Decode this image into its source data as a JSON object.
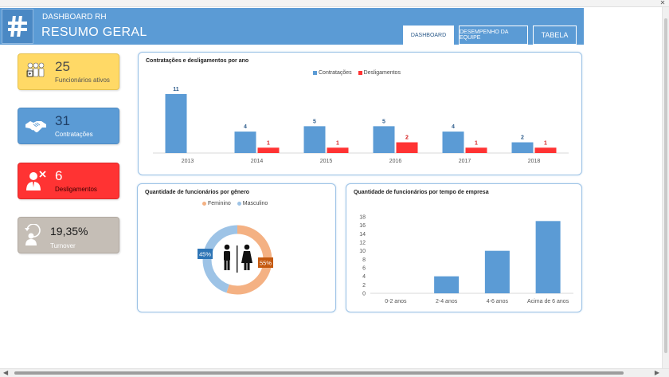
{
  "window": {
    "close_glyph": "✕"
  },
  "header": {
    "subtitle": "DASHBOARD RH",
    "title": "RESUMO GERAL",
    "tabs": [
      {
        "label": "DASHBOARD",
        "active": true
      },
      {
        "label": "DESEMPENHO DA EQUIPE",
        "active": false
      },
      {
        "label": "TABELA",
        "active": false
      }
    ]
  },
  "kpis": {
    "ativos": {
      "value": "25",
      "label": "Funcionários ativos",
      "icon": "people-icon",
      "color": "#ffd966"
    },
    "contratacoes": {
      "value": "31",
      "label": "Contratações",
      "icon": "handshake-icon",
      "color": "#5b9bd5"
    },
    "desligamentos": {
      "value": "6",
      "label": "Desligamentos",
      "icon": "person-remove-icon",
      "color": "#ff3333"
    },
    "turnover": {
      "value": "19,35%",
      "label": "Turnover",
      "icon": "person-refresh-icon",
      "color": "#c5beb6"
    }
  },
  "chart_data": [
    {
      "type": "bar",
      "title": "Contratações e desligamentos por ano",
      "categories": [
        "2013",
        "2014",
        "2015",
        "2016",
        "2017",
        "2018"
      ],
      "series": [
        {
          "name": "Contratações",
          "values": [
            11,
            4,
            5,
            5,
            4,
            2
          ],
          "color": "#5b9bd5"
        },
        {
          "name": "Desligamentos",
          "values": [
            0,
            1,
            1,
            2,
            1,
            1
          ],
          "color": "#ff3333"
        }
      ],
      "legend": "top-center",
      "data_labels": true,
      "ylim": [
        0,
        11
      ]
    },
    {
      "type": "pie",
      "subtype": "donut",
      "title": "Quantidade de funcionários por gênero",
      "categories": [
        "Feminino",
        "Masculino"
      ],
      "values": [
        55,
        45
      ],
      "labels": [
        "55%",
        "45%"
      ],
      "colors": [
        "#f4b183",
        "#9dc3e6"
      ],
      "legend": "top-center"
    },
    {
      "type": "bar",
      "title": "Quantidade de funcionários por tempo de empresa",
      "categories": [
        "0-2 anos",
        "2-4 anos",
        "4-6 anos",
        "Acima de 6 anos"
      ],
      "values": [
        0,
        4,
        10,
        17
      ],
      "ylim": [
        0,
        18
      ],
      "yticks": [
        "0",
        "2",
        "4",
        "6",
        "8",
        "10",
        "12",
        "14",
        "16",
        "18"
      ],
      "color": "#5b9bd5"
    }
  ]
}
